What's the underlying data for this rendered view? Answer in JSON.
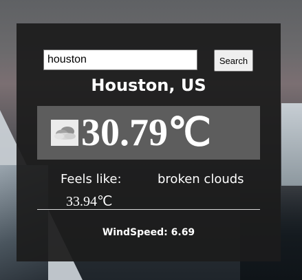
{
  "search": {
    "value": "houston",
    "button_label": "Search"
  },
  "weather": {
    "city": "Houston, US",
    "icon": "broken-clouds-icon",
    "temperature": "30.79℃",
    "feels_like_label": "Feels like:",
    "feels_like_value": "33.94℃",
    "description": "broken clouds",
    "wind": "WindSpeed: 6.69"
  }
}
